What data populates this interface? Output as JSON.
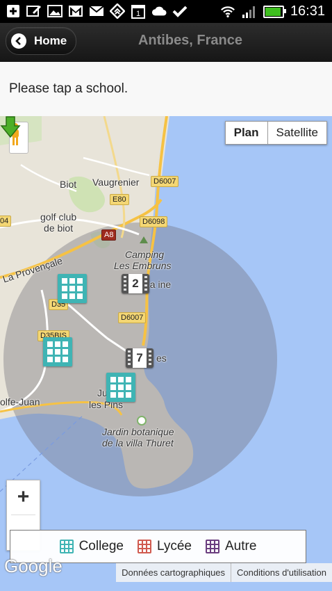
{
  "status_bar": {
    "time": "16:31",
    "icons": [
      "plus-notification-icon",
      "edit-icon",
      "image-icon",
      "gmail-icon",
      "mail-icon",
      "feedly-icon",
      "calendar-icon",
      "cloud-icon",
      "check-icon",
      "wifi-icon",
      "signal-icon",
      "battery-icon"
    ],
    "calendar_day": "1"
  },
  "header": {
    "back_label": "Home",
    "title": "Antibes, France"
  },
  "prompt": "Please tap a school.",
  "map": {
    "type_buttons": [
      "Plan",
      "Satellite"
    ],
    "active_type": "Plan",
    "labels": {
      "biot": "Biot",
      "vaugrenier": "Vaugrenier",
      "golf": "golf club\nde biot",
      "provencale": "La Provençale",
      "camping1": "Camping",
      "camping2": "Les Embruns",
      "pins1": "Ju",
      "pins2": "les Pins",
      "jardin1": "Jardin botanique",
      "jardin2": "de la villa Thuret",
      "golfe": "olfe-Juan",
      "la_fontaine": "La   ine",
      "les": "es"
    },
    "roads": {
      "d6007_top": "D6007",
      "e80": "E80",
      "d6098": "D6098",
      "a8": "A8",
      "d35": "D35",
      "d35bis": "D35BIS",
      "d6007_mid": "D6007",
      "d04": "04"
    },
    "clusters": [
      "2",
      "7"
    ],
    "zoom_in": "+",
    "zoom_out": "−",
    "google": "Google",
    "attribution": [
      "Données cartographiques",
      "Conditions d'utilisation"
    ]
  },
  "legend": [
    {
      "label": "College",
      "color": "#3fb4b4"
    },
    {
      "label": "Lycée",
      "color": "#d05a4f"
    },
    {
      "label": "Autre",
      "color": "#6a3d7f"
    }
  ],
  "colors": {
    "sea": "#a6c6f7",
    "land": "#e9e5dc",
    "radius_overlay": "#6f6f7a",
    "college": "#3fb4b4",
    "arrow": "#4caf28"
  }
}
